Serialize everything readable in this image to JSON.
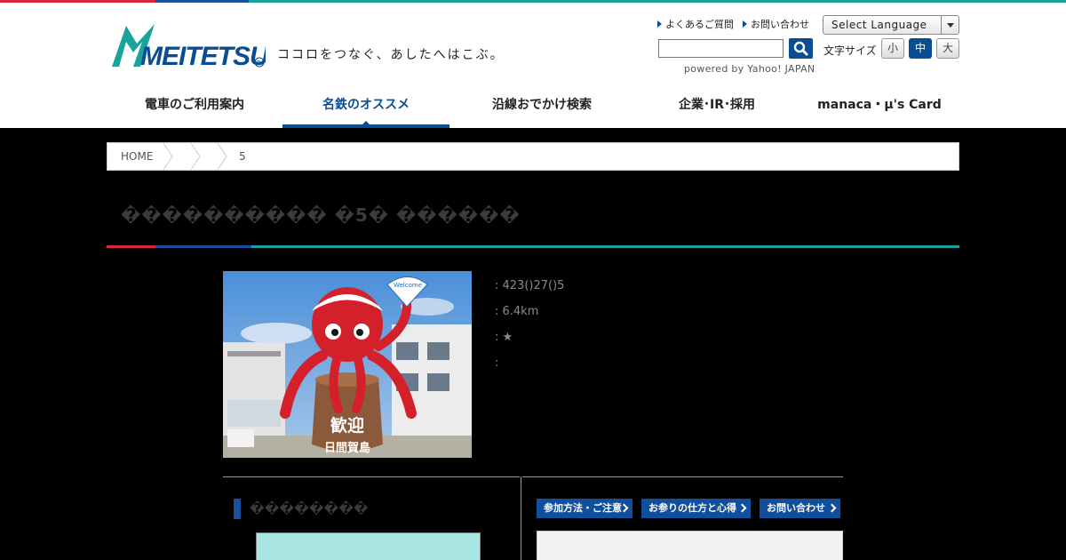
{
  "header": {
    "logo_text": "MEITETSU",
    "tagline": "ココロをつなぐ、あしたへはこぶ。",
    "links": [
      {
        "label": "よくあるご質問"
      },
      {
        "label": "お問い合わせ"
      }
    ],
    "language_select": "Select Language",
    "search_placeholder": "",
    "powered_by": "powered by Yahoo! JAPAN",
    "font_size_label": "文字サイズ",
    "font_size_buttons": [
      {
        "label": "小"
      },
      {
        "label": "中",
        "active": true
      },
      {
        "label": "大"
      }
    ]
  },
  "nav": {
    "items": [
      {
        "label": "電車のご利用案内"
      },
      {
        "label": "名鉄のオススメ",
        "active": true
      },
      {
        "label": "沿線おでかけ検索"
      },
      {
        "label": "企業･IR･採用"
      },
      {
        "label": "manaca・μ's Card"
      }
    ]
  },
  "breadcrumb": {
    "home": "HOME",
    "last": "5"
  },
  "page": {
    "title": "���������� �5� ������",
    "info": [
      {
        "text": ": 423()27()5"
      },
      {
        "text": ": 6.4km"
      },
      {
        "text": ": ★"
      },
      {
        "text": ":"
      }
    ],
    "photo": {
      "sign_top": "歓迎",
      "sign_bottom": "日間賀島",
      "fan_text": "Welcome"
    },
    "section_heading": "��������",
    "buttons": [
      {
        "label": "参加方法・ご注意"
      },
      {
        "label": "お参りの仕方と心得"
      },
      {
        "label": "お問い合わせ"
      }
    ]
  },
  "colors": {
    "brand_blue": "#0a4d95",
    "red": "#d7263d",
    "teal": "#1aa39a",
    "map_bg": "#a9e5e2"
  }
}
